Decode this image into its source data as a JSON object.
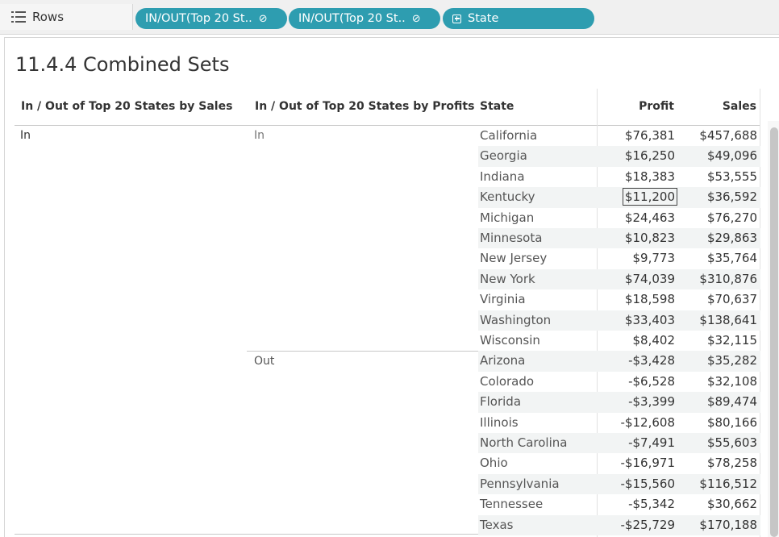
{
  "shelf": {
    "label": "Rows",
    "pills": [
      {
        "label": "IN/OUT(Top 20 St..",
        "icon": "linked-set-icon"
      },
      {
        "label": "IN/OUT(Top 20 St..",
        "icon": "linked-set-icon"
      },
      {
        "label": "State",
        "icon": "plus-box-icon"
      }
    ]
  },
  "title": "11.4.4 Combined Sets",
  "headers": {
    "col1": "In / Out of Top 20 States by Sales",
    "col2": "In / Out of Top 20 States by Profits",
    "col3": "State",
    "col4": "Profit",
    "col5": "Sales"
  },
  "groups": {
    "sales_in": "In",
    "profit_in": "In",
    "profit_out": "Out"
  },
  "rows": [
    {
      "state": "California",
      "profit": "$76,381",
      "sales": "$457,688"
    },
    {
      "state": "Georgia",
      "profit": "$16,250",
      "sales": "$49,096"
    },
    {
      "state": "Indiana",
      "profit": "$18,383",
      "sales": "$53,555"
    },
    {
      "state": "Kentucky",
      "profit": "$11,200",
      "sales": "$36,592",
      "selected": true
    },
    {
      "state": "Michigan",
      "profit": "$24,463",
      "sales": "$76,270"
    },
    {
      "state": "Minnesota",
      "profit": "$10,823",
      "sales": "$29,863"
    },
    {
      "state": "New Jersey",
      "profit": "$9,773",
      "sales": "$35,764"
    },
    {
      "state": "New York",
      "profit": "$74,039",
      "sales": "$310,876"
    },
    {
      "state": "Virginia",
      "profit": "$18,598",
      "sales": "$70,637"
    },
    {
      "state": "Washington",
      "profit": "$33,403",
      "sales": "$138,641"
    },
    {
      "state": "Wisconsin",
      "profit": "$8,402",
      "sales": "$32,115"
    },
    {
      "state": "Arizona",
      "profit": "-$3,428",
      "sales": "$35,282"
    },
    {
      "state": "Colorado",
      "profit": "-$6,528",
      "sales": "$32,108"
    },
    {
      "state": "Florida",
      "profit": "-$3,399",
      "sales": "$89,474"
    },
    {
      "state": "Illinois",
      "profit": "-$12,608",
      "sales": "$80,166"
    },
    {
      "state": "North Carolina",
      "profit": "-$7,491",
      "sales": "$55,603"
    },
    {
      "state": "Ohio",
      "profit": "-$16,971",
      "sales": "$78,258"
    },
    {
      "state": "Pennsylvania",
      "profit": "-$15,560",
      "sales": "$116,512"
    },
    {
      "state": "Tennessee",
      "profit": "-$5,342",
      "sales": "$30,662"
    },
    {
      "state": "Texas",
      "profit": "-$25,729",
      "sales": "$170,188"
    }
  ]
}
